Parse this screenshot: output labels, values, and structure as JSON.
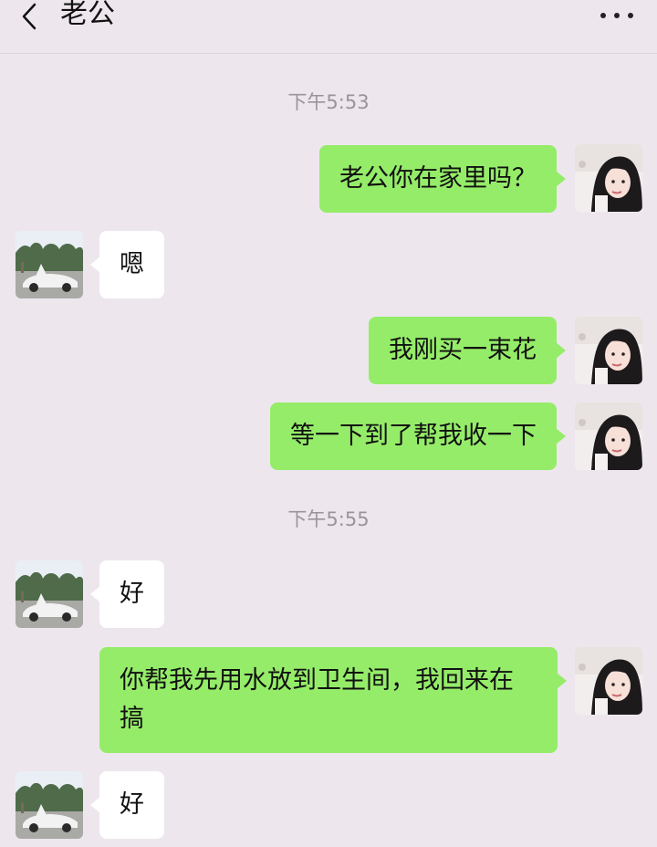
{
  "header": {
    "title": "老公",
    "back_icon": "chevron-left-icon",
    "more_icon": "more-dots-icon"
  },
  "colors": {
    "background": "#ede7ed",
    "outgoing_bubble": "#95ec69",
    "incoming_bubble": "#ffffff",
    "timestamp_text": "#9a949a"
  },
  "chat": {
    "timestamps": [
      "下午5:53",
      "下午5:55"
    ],
    "messages": [
      {
        "sender": "me",
        "text": "老公你在家里吗？"
      },
      {
        "sender": "other",
        "text": "嗯"
      },
      {
        "sender": "me",
        "text": "我刚买一束花"
      },
      {
        "sender": "me",
        "text": "等一下到了帮我收一下"
      },
      {
        "sender": "other",
        "text": "好"
      },
      {
        "sender": "me",
        "text": "你帮我先用水放到卫生间，我回来在搞"
      },
      {
        "sender": "other",
        "text": "好"
      }
    ]
  }
}
